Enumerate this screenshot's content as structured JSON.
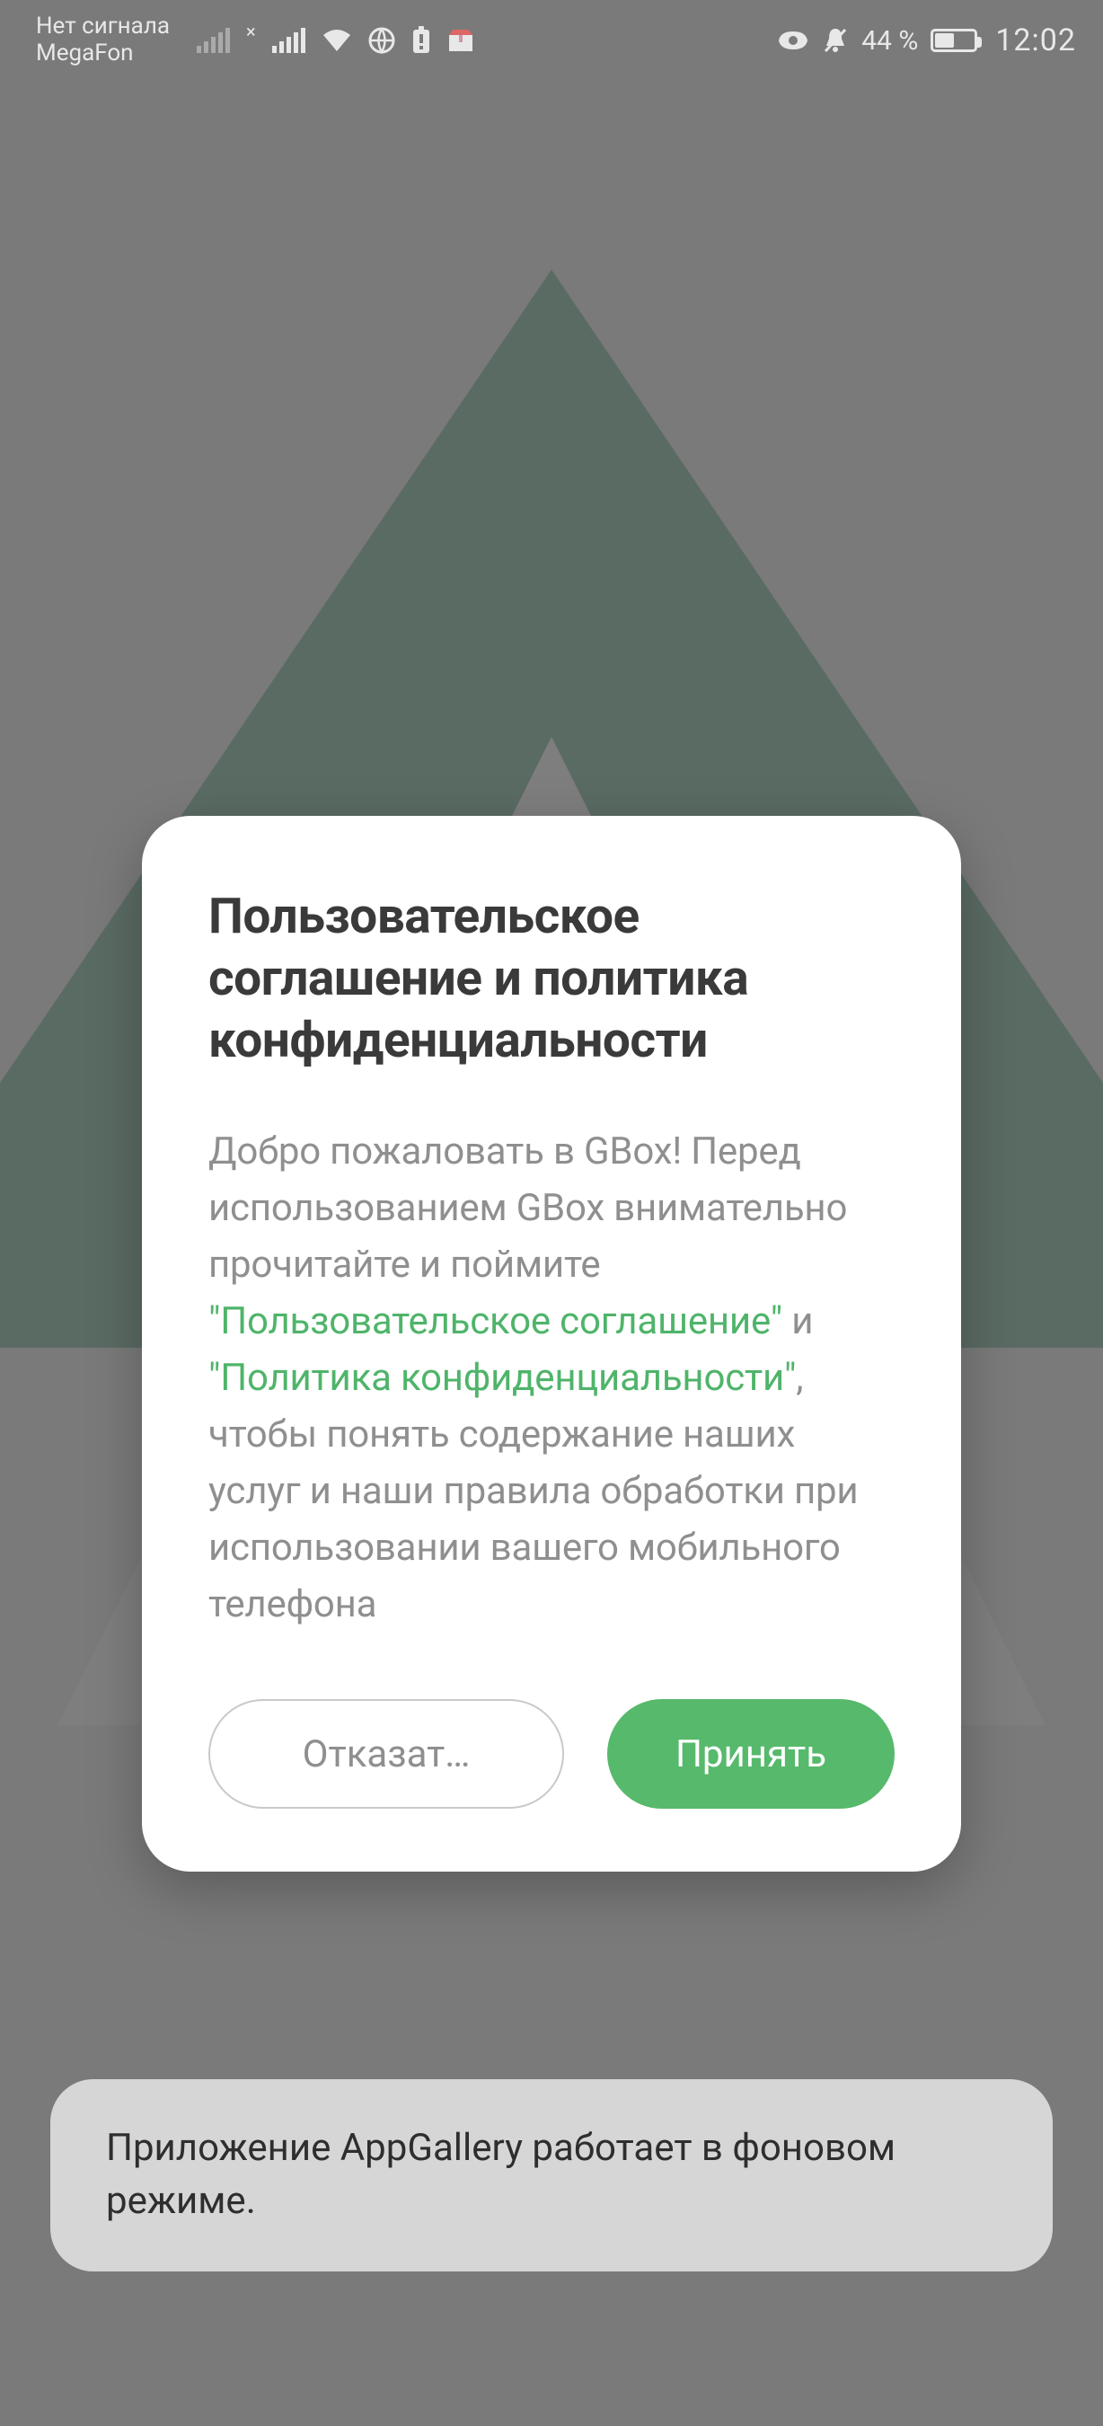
{
  "status": {
    "carrier_line1": "Нет сигнала",
    "carrier_line2": "MegaFon",
    "battery_text": "44 %",
    "time": "12:02"
  },
  "dialog": {
    "title": "Пользовательское соглашение и политика конфиденциальности",
    "body_pre": "Добро пожаловать в GBox! Перед использованием GBox внимательно прочитайте и поймите ",
    "link1": "\"Пользовательское соглашение\"",
    "and": " и ",
    "link2": "\"Политика конфиденциальности\"",
    "body_post": ", чтобы понять содержание наших услуг и наши правила обработки при использовании вашего мобильного телефона",
    "decline_label": "Отказат…",
    "accept_label": "Принять"
  },
  "toast": {
    "text": "Приложение AppGallery работает в фоновом режиме."
  }
}
